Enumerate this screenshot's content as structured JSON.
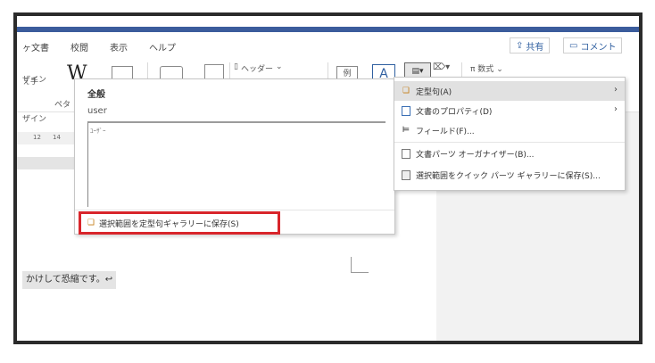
{
  "tabs": [
    {
      "label": "ヶ文書"
    },
    {
      "label": "校閲"
    },
    {
      "label": "表示"
    },
    {
      "label": "ヘルプ"
    }
  ],
  "header_buttons": {
    "share": "共有",
    "comment": "コメント"
  },
  "ribbon": {
    "font_fragment": "ぇ手",
    "header_label": "ヘッダー",
    "example_label": "例",
    "a_label": "A",
    "equation_label": "数式",
    "design_fragment": "ザイン",
    "peta_fragment": "ペタ",
    "design_fragment2": "ザイン",
    "ruler_ticks": [
      "12",
      "14"
    ]
  },
  "gallery": {
    "category": "全般",
    "entry_name": "user",
    "preview_text": "ﾕｰｻﾞｰ",
    "save_selection_label": "選択範囲を定型句ギャラリーに保存(S)"
  },
  "context_menu": {
    "items": [
      {
        "label": "定型句(A)",
        "icon": "quick-parts-icon",
        "has_submenu": true
      },
      {
        "label": "文書のプロパティ(D)",
        "icon": "document-properties-icon",
        "has_submenu": true
      },
      {
        "label": "フィールド(F)...",
        "icon": "field-icon",
        "has_submenu": false
      },
      {
        "label": "文書パーツ オーガナイザー(B)...",
        "icon": "building-blocks-icon",
        "has_submenu": false
      },
      {
        "label": "選択範囲をクイック パーツ ギャラリーに保存(S)...",
        "icon": "save-selection-icon",
        "has_submenu": false
      }
    ]
  },
  "document": {
    "body_text": "かけして恐縮です。↩"
  }
}
